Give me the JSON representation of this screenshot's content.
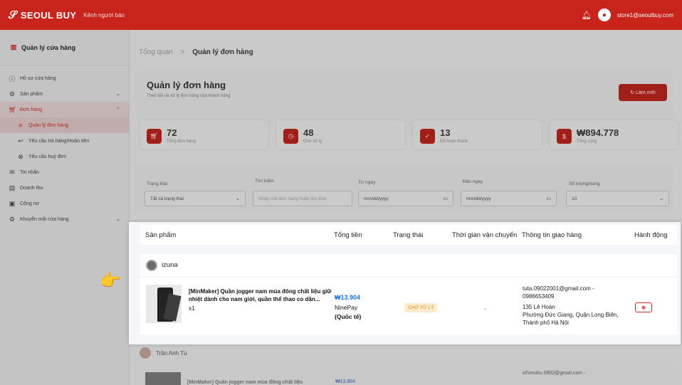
{
  "header": {
    "brand": "SEOUL BUY",
    "tagline": "Kênh người bán",
    "bell_icon": "bell-icon",
    "avatar_letter": "👤",
    "user_email": "store1@seoulbuy.com"
  },
  "sidebar": {
    "title": "Quản lý cửa hàng",
    "items": [
      {
        "label": "Hồ sơ cửa hàng",
        "icon": "info-icon"
      },
      {
        "label": "Sản phẩm",
        "icon": "gear-icon",
        "chevron": "⌄"
      },
      {
        "label": "Đơn hàng",
        "icon": "cart-icon",
        "chevron": "⌃"
      },
      {
        "label": "Quản lý đơn hàng"
      },
      {
        "label": "Yêu cầu trả hàng/Hoàn tiền"
      },
      {
        "label": "Yêu cầu huỷ đơn"
      },
      {
        "label": "Tin nhắn",
        "icon": "chat-icon"
      },
      {
        "label": "Doanh thu",
        "icon": "chart-icon"
      },
      {
        "label": "Công nợ",
        "icon": "debt-icon"
      },
      {
        "label": "Khuyến mãi cửa hàng",
        "icon": "gear-icon",
        "chevron": "⌄"
      }
    ]
  },
  "breadcrumb": {
    "home": "Tổng quan",
    "separator": ">",
    "current": "Quản lý đơn hàng"
  },
  "page": {
    "title": "Quản lý đơn hàng",
    "subtitle": "Theo dõi và xử lý đơn hàng của khách hàng",
    "refresh_label": "↻ Làm mới"
  },
  "stats": [
    {
      "value": "72",
      "label": "Tổng đơn hàng",
      "icon": "cart-icon"
    },
    {
      "value": "48",
      "label": "Chờ xử lý",
      "icon": "clock-icon"
    },
    {
      "value": "13",
      "label": "Đã hoàn thành",
      "icon": "check-icon"
    },
    {
      "value": "₩894.778",
      "label": "Tổng cộng",
      "icon": "dollar-icon"
    }
  ],
  "filters": {
    "status_label": "Trạng thái",
    "status_value": "Tất cả trạng thái",
    "search_label": "Tìm kiếm",
    "search_placeholder": "Nhập mã đơn hàng hoặc tên khá",
    "from_label": "Từ ngày",
    "from_value": "mm/dd/yyyy",
    "to_label": "Đến ngày",
    "to_value": "mm/dd/yyyy",
    "per_page_label": "Số lượng/trang",
    "per_page_value": "10"
  },
  "table": {
    "columns": [
      "Sản phẩm",
      "Tổng tiền",
      "Trạng thái",
      "Thời gian vận chuyển",
      "Thông tin giao hàng",
      "Hành động"
    ],
    "shop": "izuna",
    "order": {
      "product_name": "[MinMaker] Quần jogger nam mùa đông chất liệu giữ nhiệt dành cho nam giới, quần thể thao co dãn...",
      "quantity": "x1",
      "price": "₩13.904",
      "payment": "NinePay",
      "payment_type": "(Quốc tế)",
      "status": "CHỜ XỬ LÝ",
      "shipping_time": "-",
      "email": "tuta.09022001@gmail.com -",
      "phone": "0986653409",
      "street": "135 Lê Hoàn",
      "area": "Phường Đức Giang, Quận Long Biên,",
      "city": "Thành phố Hà Nội",
      "view_icon": "eye-icon"
    },
    "next_shop": "Trần Anh Tú",
    "next_product": "[MinMaker] Quần jogger nam mùa đông chất liệu",
    "next_price": "₩13.904",
    "next_email": "ichimoku.0902@gmail.com -"
  },
  "colors": {
    "brand_red": "#c8241c",
    "price_blue": "#1e73e8",
    "status_orange": "#e08a00"
  }
}
